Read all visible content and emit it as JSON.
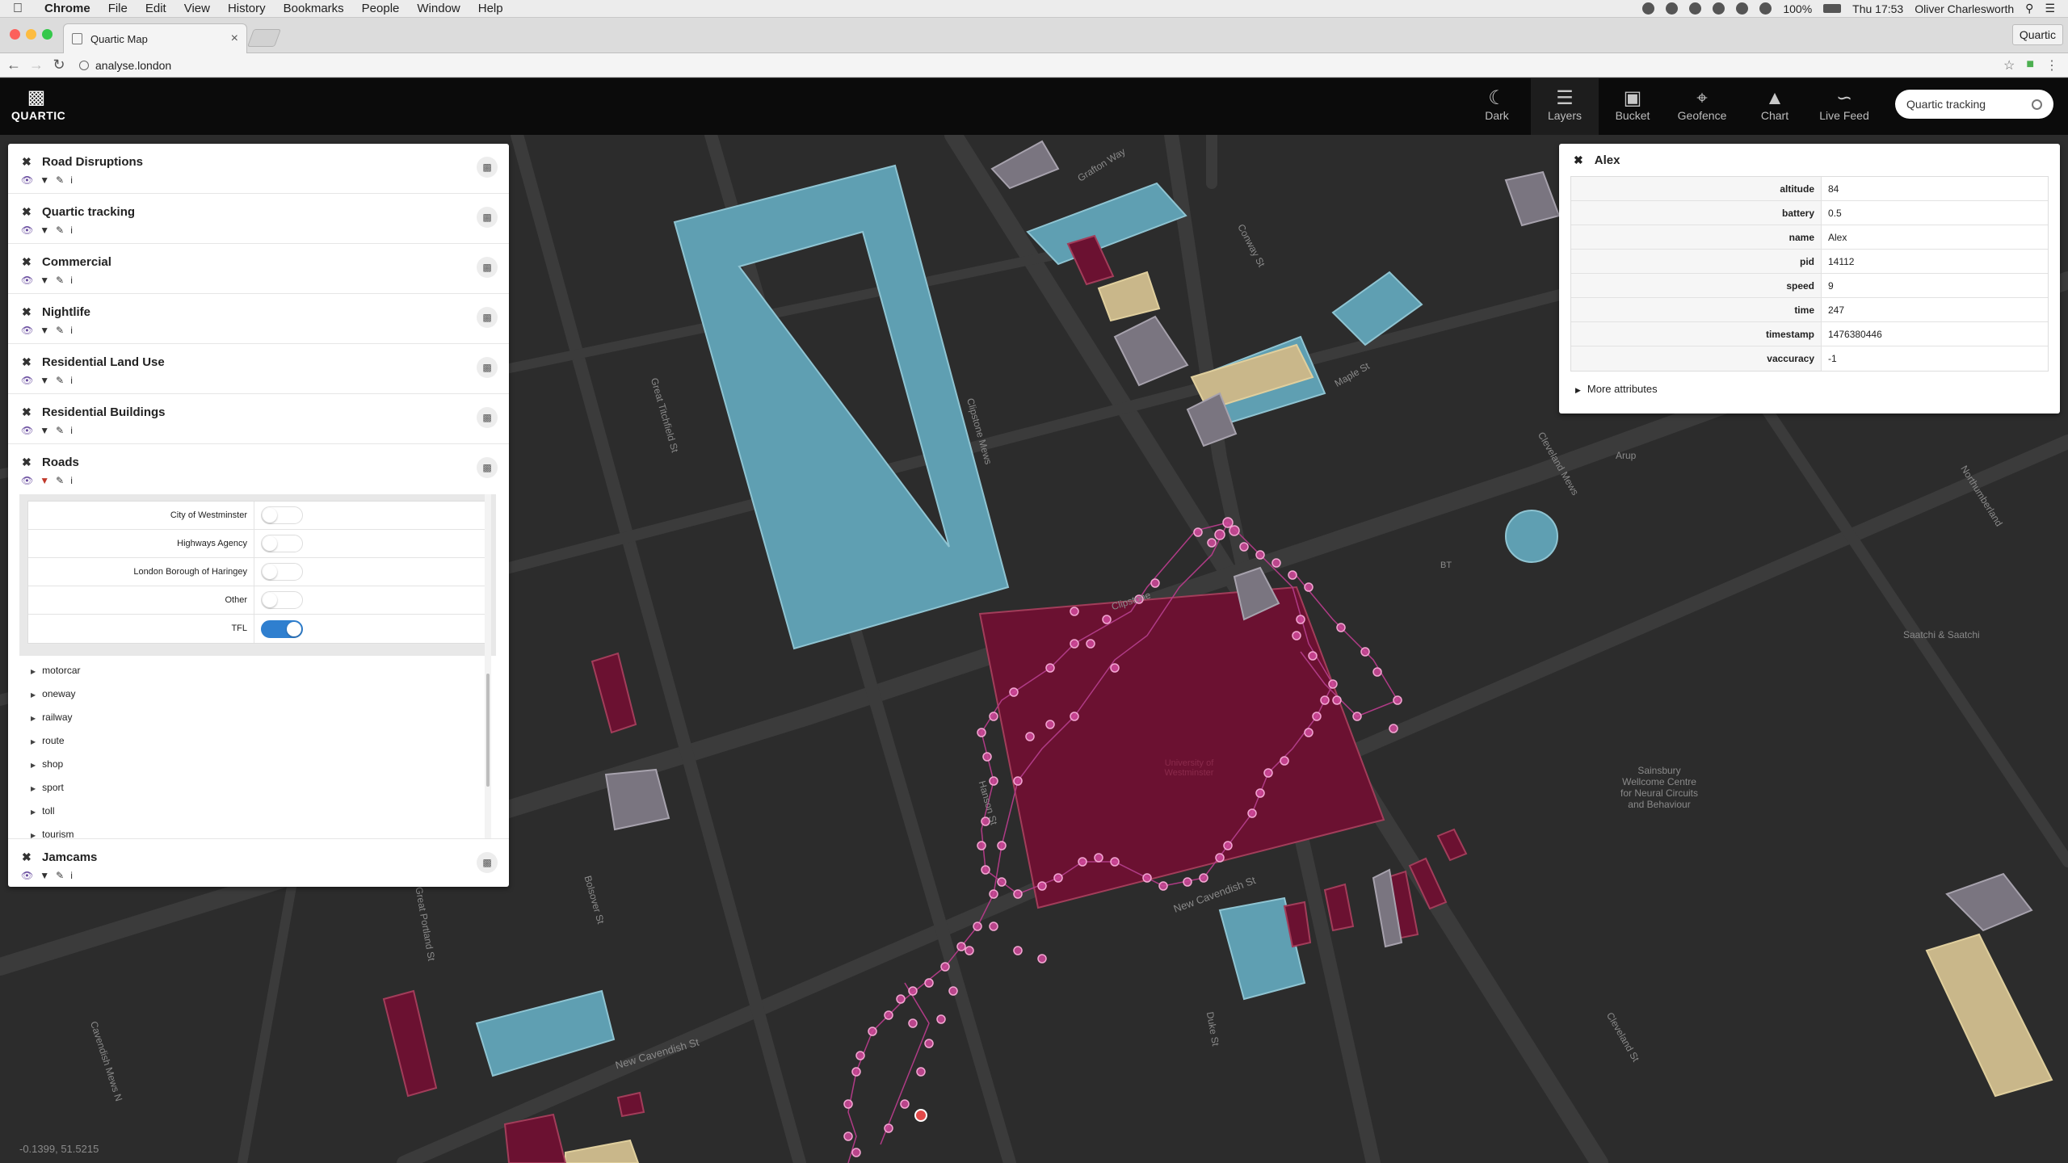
{
  "menubar": {
    "app": "Chrome",
    "items": [
      "File",
      "Edit",
      "View",
      "History",
      "Bookmarks",
      "People",
      "Window",
      "Help"
    ],
    "battery": "100%",
    "clock": "Thu 17:53",
    "user": "Oliver Charlesworth"
  },
  "browser": {
    "tab_title": "Quartic Map",
    "profile": "Quartic",
    "url": "analyse.london"
  },
  "app": {
    "logo": "QUARTIC",
    "nav": [
      {
        "label": "Dark",
        "icon": "moon-icon"
      },
      {
        "label": "Layers",
        "icon": "layers-icon"
      },
      {
        "label": "Bucket",
        "icon": "bucket-icon"
      },
      {
        "label": "Geofence",
        "icon": "crop-icon"
      },
      {
        "label": "Chart",
        "icon": "area-chart-icon"
      },
      {
        "label": "Live Feed",
        "icon": "rss-icon"
      }
    ],
    "search_value": "Quartic tracking"
  },
  "layers": [
    {
      "name": "Road Disruptions"
    },
    {
      "name": "Quartic tracking"
    },
    {
      "name": "Commercial"
    },
    {
      "name": "Nightlife"
    },
    {
      "name": "Residential Land Use"
    },
    {
      "name": "Residential Buildings"
    },
    {
      "name": "Roads"
    },
    {
      "name": "Jamcams"
    }
  ],
  "roads_filter": {
    "rows": [
      {
        "label": "City of Westminster",
        "on": false
      },
      {
        "label": "Highways Agency",
        "on": false
      },
      {
        "label": "London Borough of Haringey",
        "on": false
      },
      {
        "label": "Other",
        "on": false
      },
      {
        "label": "TFL",
        "on": true
      }
    ],
    "attributes": [
      "motorcar",
      "oneway",
      "railway",
      "route",
      "shop",
      "sport",
      "toll",
      "tourism"
    ]
  },
  "detail": {
    "title": "Alex",
    "rows": [
      {
        "key": "altitude",
        "value": "84"
      },
      {
        "key": "battery",
        "value": "0.5"
      },
      {
        "key": "name",
        "value": "Alex"
      },
      {
        "key": "pid",
        "value": "14112"
      },
      {
        "key": "speed",
        "value": "9"
      },
      {
        "key": "time",
        "value": "247"
      },
      {
        "key": "timestamp",
        "value": "1476380446"
      },
      {
        "key": "vaccuracy",
        "value": "-1"
      }
    ],
    "more": "More attributes"
  },
  "map": {
    "labels": {
      "arup": "Arup",
      "bt": "BT",
      "saatchi": "Saatchi & Saatchi",
      "sainsbury": "Sainsbury Wellcome Centre for Neural Circuits and Behaviour",
      "university": "University of Westminster",
      "new_cav_1": "New Cavendish St",
      "new_cav_2": "New Cavendish St",
      "great_titchfield": "Great Titchfield St",
      "clipstone_mews": "Clipstone Mews",
      "great_portland": "Great Portland St",
      "bolsover": "Bolsover St",
      "hanson": "Hanson St",
      "clipstone": "Clipstone",
      "cleveland_st": "Cleveland St",
      "cleveland_mews": "Cleveland Mews",
      "maple": "Maple St",
      "conway": "Conway St",
      "grafton": "Grafton Way",
      "cavendish_mews": "Cavendish Mews N",
      "duke": "Duke St",
      "northumb": "Northumberland"
    },
    "coords": "-0.1399, 51.5215",
    "colors": {
      "background": "#2c2c2c",
      "road": "#3a3a3a",
      "commercial": "#5f9fb2",
      "nightlife": "#6b1131",
      "residential": "#c9b78a",
      "grey_building": "#7a7580",
      "track": "#d24a9c"
    }
  }
}
